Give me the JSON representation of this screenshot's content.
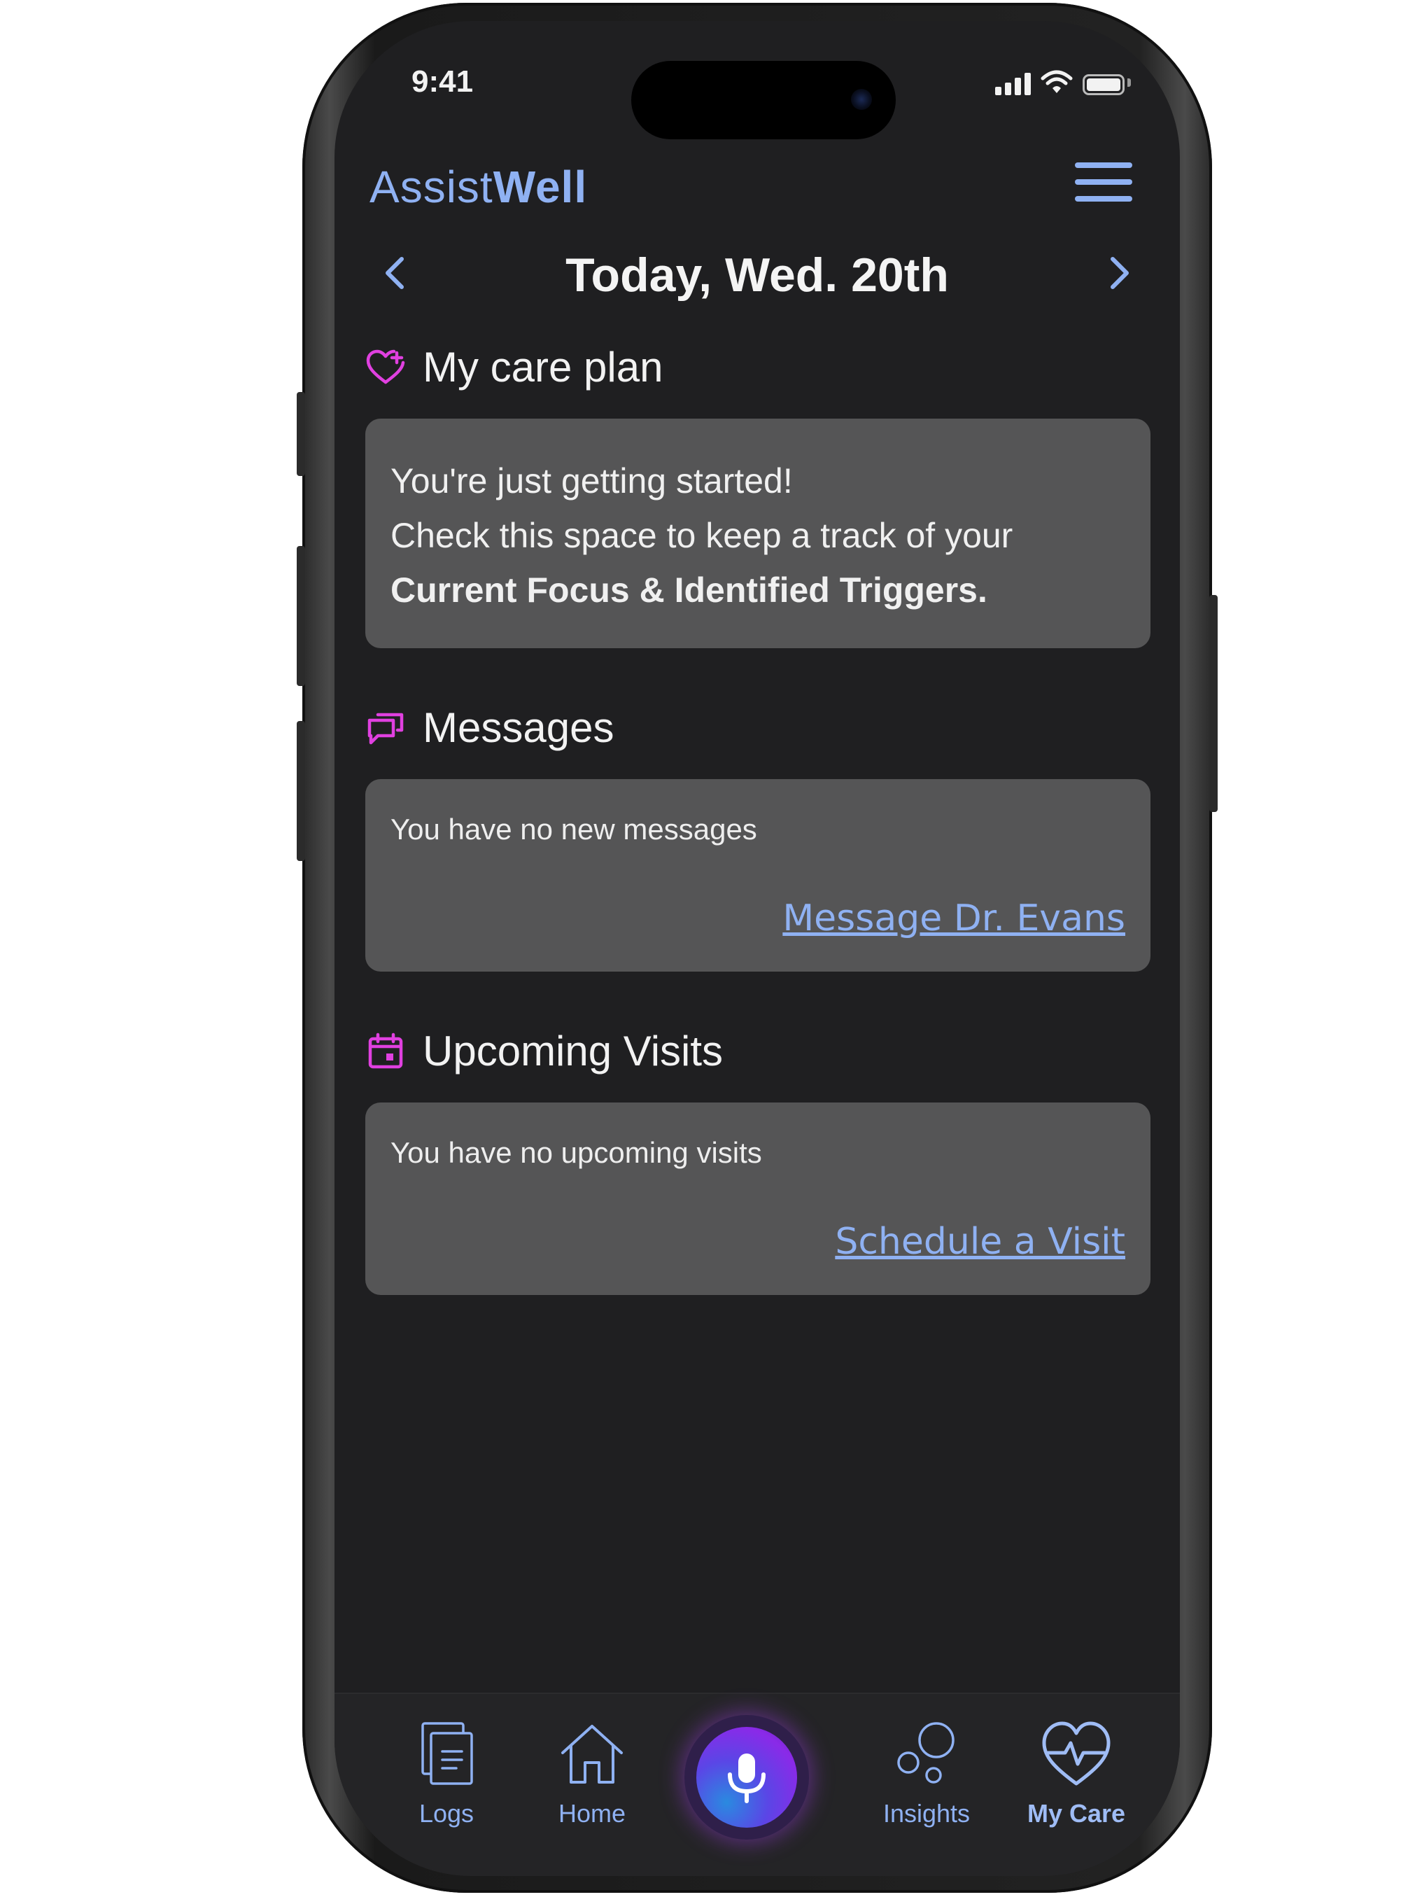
{
  "status_bar": {
    "time": "9:41"
  },
  "header": {
    "brand_light": "Assist",
    "brand_bold": "Well"
  },
  "date_nav": {
    "title": "Today, Wed. 20th"
  },
  "care_plan": {
    "heading": "My care plan",
    "line1": "You're just getting started!",
    "line2": "Check this space to keep a track of your",
    "line3": "Current Focus & Identified Triggers."
  },
  "messages": {
    "heading": "Messages",
    "info": "You have no new messages",
    "link": "Message Dr. Evans"
  },
  "visits": {
    "heading": "Upcoming Visits",
    "info": "You have no upcoming visits",
    "link": "Schedule a Visit"
  },
  "tabbar": {
    "logs": "Logs",
    "home": "Home",
    "insights": "Insights",
    "my_care": "My Care",
    "active": "My Care"
  },
  "colors": {
    "accent": "#8fb1f2",
    "section_icon": "#e040e0",
    "background": "#1f1f21",
    "card": "#555556"
  }
}
